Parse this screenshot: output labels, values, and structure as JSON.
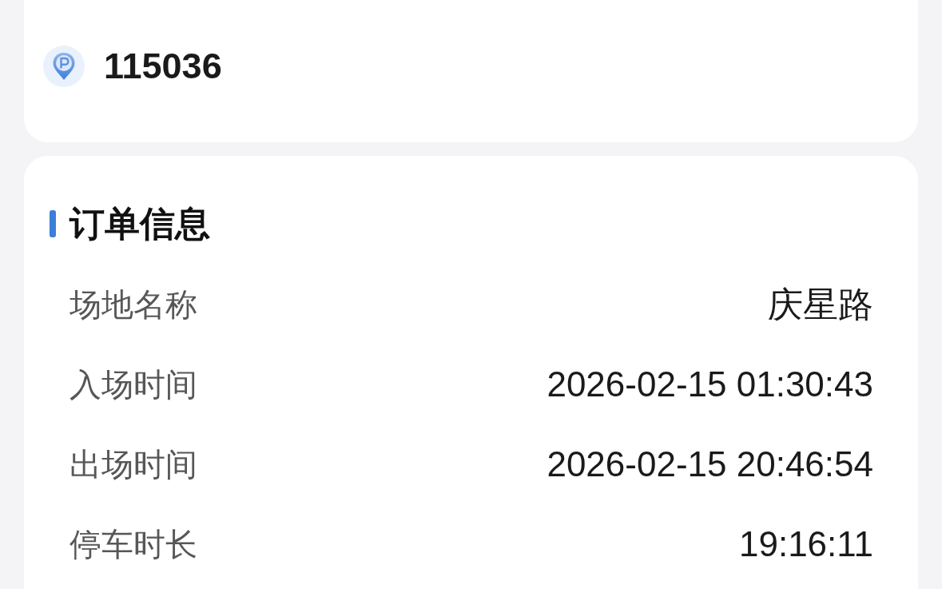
{
  "parking_card": {
    "parking_code": "115036"
  },
  "order_info": {
    "title": "订单信息",
    "rows": [
      {
        "label": "场地名称",
        "value": "庆星路"
      },
      {
        "label": "入场时间",
        "value": "2026-02-15 01:30:43"
      },
      {
        "label": "出场时间",
        "value": "2026-02-15 20:46:54"
      },
      {
        "label": "停车时长",
        "value": "19:16:11"
      }
    ]
  }
}
